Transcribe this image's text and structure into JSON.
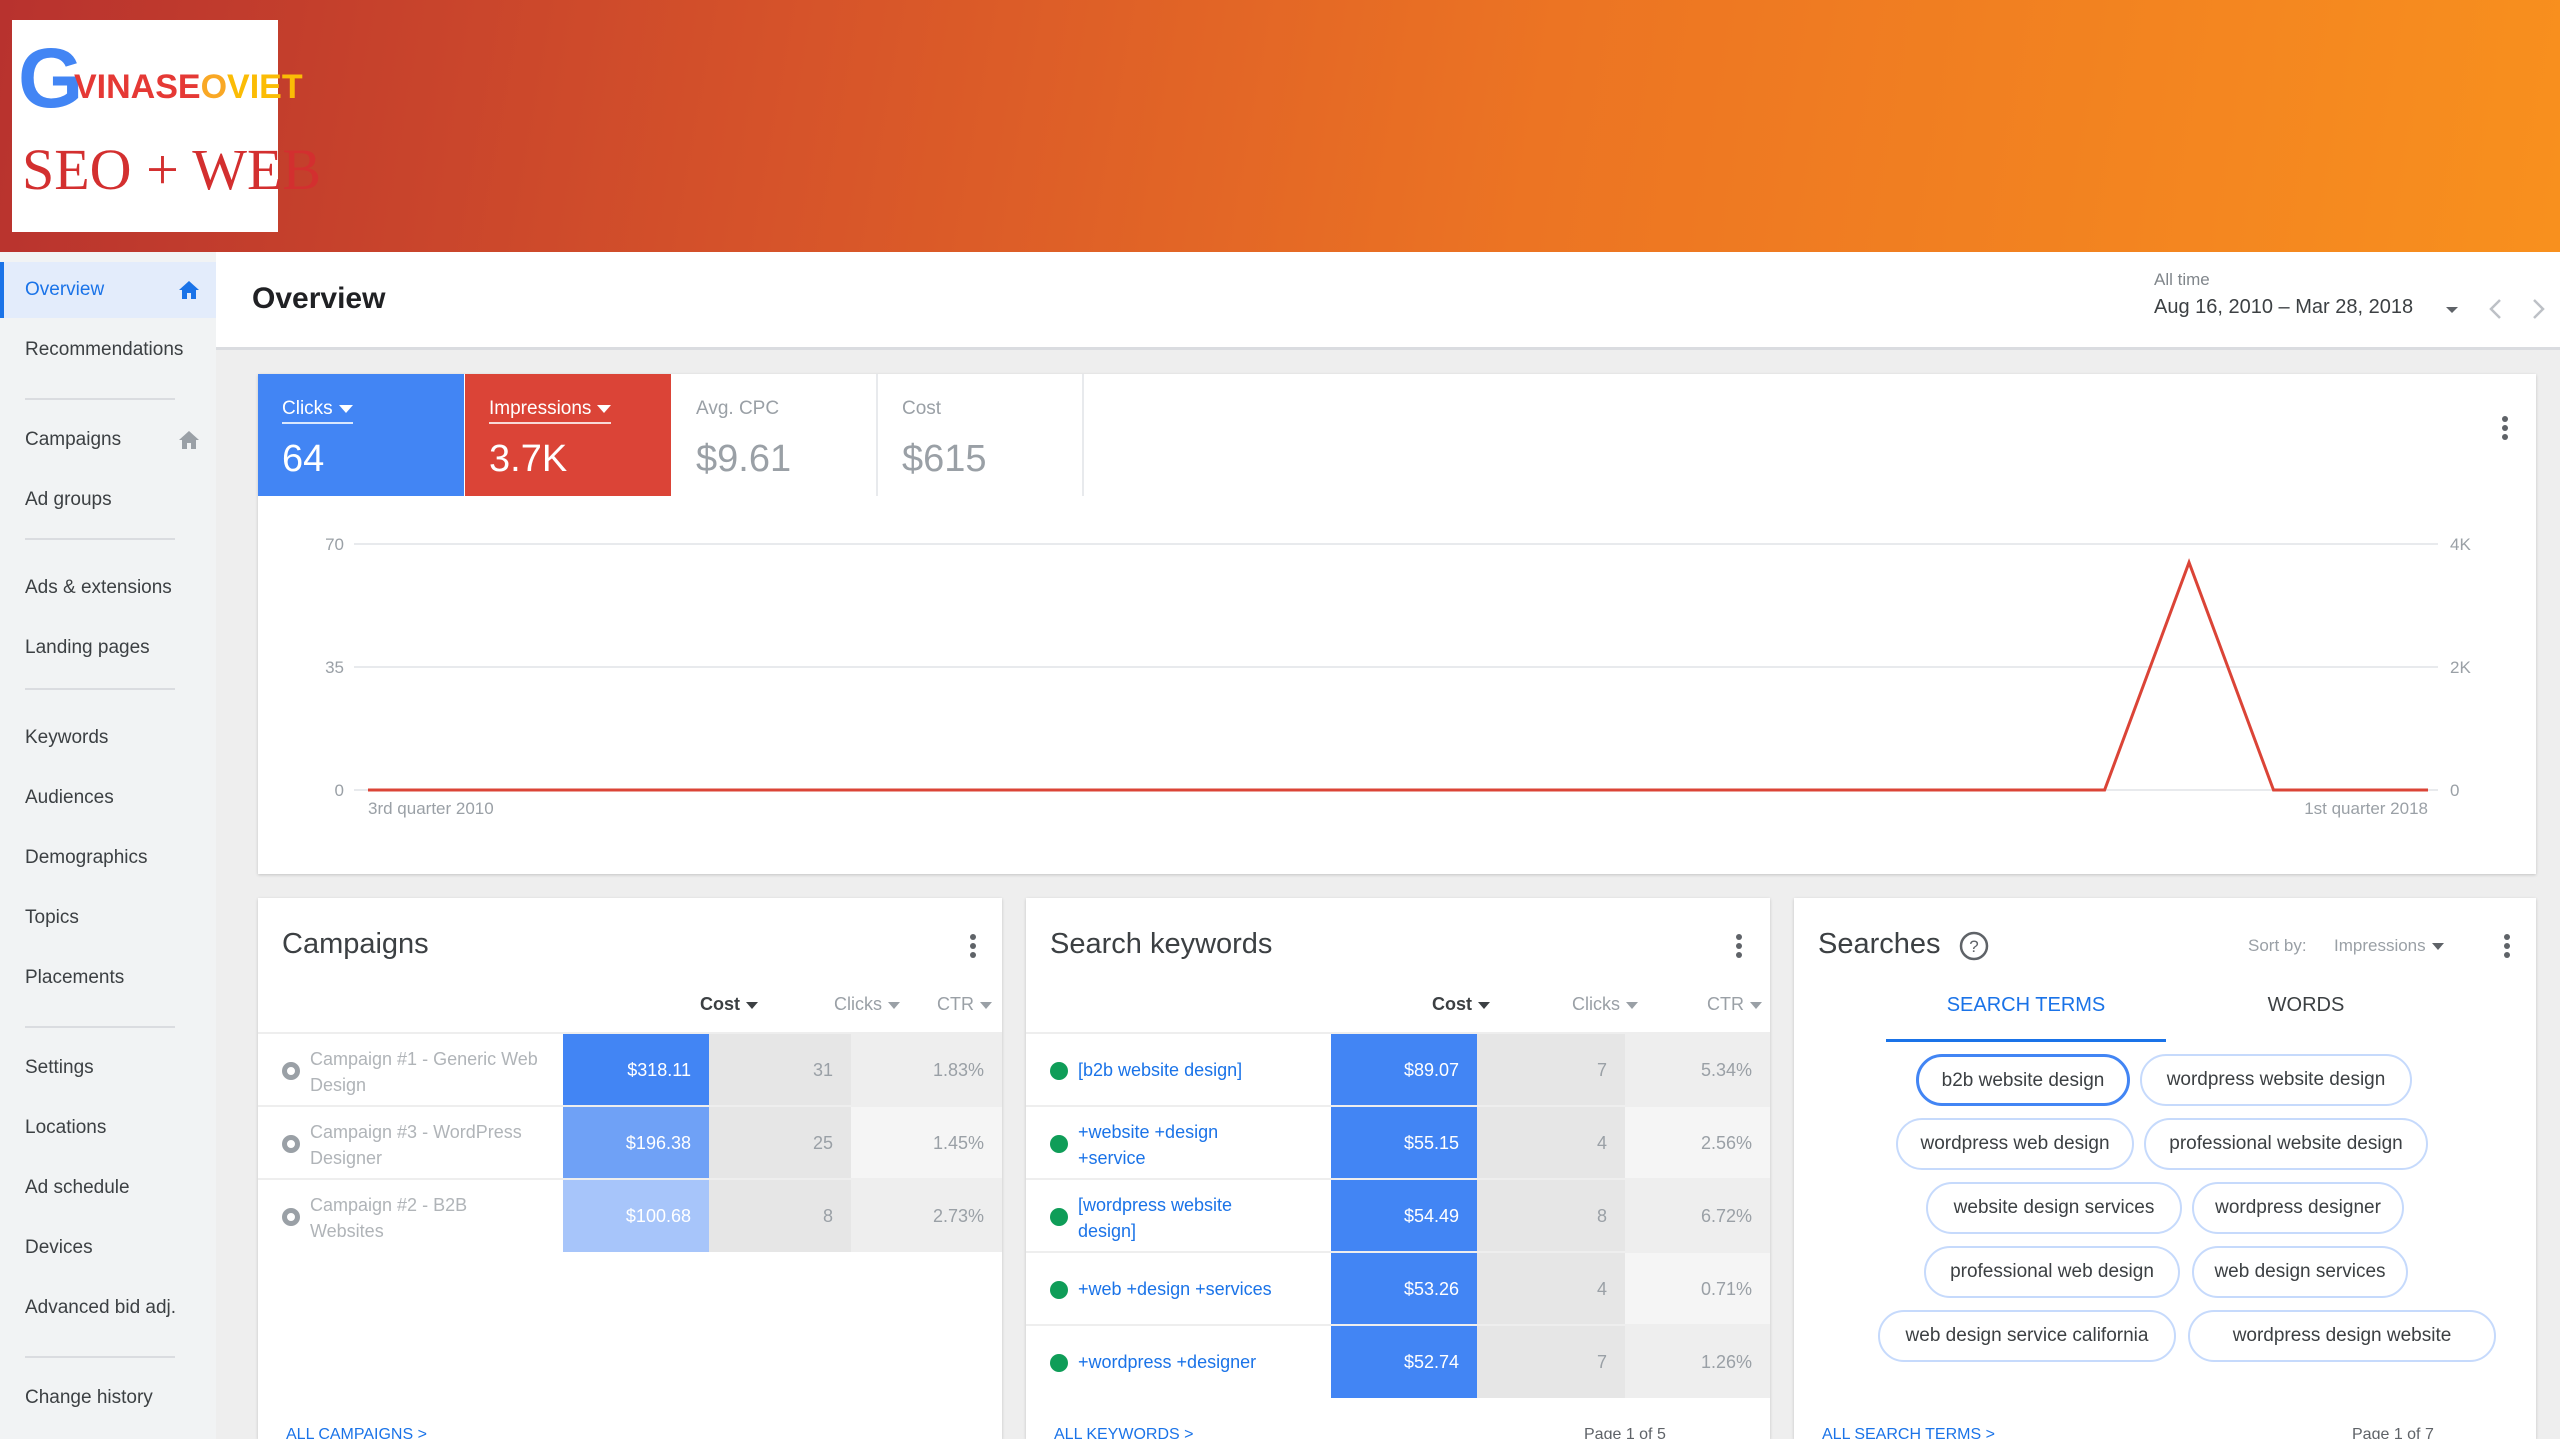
{
  "brand": {
    "logo_letter": "G",
    "logo_name_a": "VINASE",
    "logo_name_b": "O",
    "logo_name_c": "VIET",
    "tagline": "SEO + WEB"
  },
  "sidebar": {
    "items": [
      {
        "label": "Overview",
        "active": true
      },
      {
        "label": "Recommendations"
      },
      {
        "label": "Campaigns"
      },
      {
        "label": "Ad groups"
      },
      {
        "label": "Ads & extensions"
      },
      {
        "label": "Landing pages"
      },
      {
        "label": "Keywords"
      },
      {
        "label": "Audiences"
      },
      {
        "label": "Demographics"
      },
      {
        "label": "Topics"
      },
      {
        "label": "Placements"
      },
      {
        "label": "Settings"
      },
      {
        "label": "Locations"
      },
      {
        "label": "Ad schedule"
      },
      {
        "label": "Devices"
      },
      {
        "label": "Advanced bid adj."
      },
      {
        "label": "Change history"
      }
    ]
  },
  "header": {
    "title": "Overview",
    "date_label": "All time",
    "date_range": "Aug 16, 2010 – Mar 28, 2018"
  },
  "metrics": {
    "clicks": {
      "label": "Clicks",
      "value": "64",
      "color": "#4285f4"
    },
    "impressions": {
      "label": "Impressions",
      "value": "3.7K",
      "color": "#db4437"
    },
    "avg_cpc": {
      "label": "Avg. CPC",
      "value": "$9.61"
    },
    "cost": {
      "label": "Cost",
      "value": "$615"
    }
  },
  "chart_data": {
    "type": "line",
    "x_labels": [
      "3rd quarter 2010",
      "1st quarter 2018"
    ],
    "y_left_ticks": [
      "70",
      "35",
      "0"
    ],
    "y_right_ticks": [
      "4K",
      "2K",
      "0"
    ],
    "ylim_left": [
      0,
      70
    ],
    "ylim_right": [
      0,
      4000
    ],
    "series": [
      {
        "name": "Impressions",
        "color": "#db4437",
        "axis": "right",
        "points": [
          [
            0,
            0
          ],
          [
            0.843,
            0
          ],
          [
            0.884,
            3700
          ],
          [
            0.925,
            0
          ],
          [
            1,
            0
          ]
        ]
      }
    ],
    "grid": true
  },
  "campaigns": {
    "title": "Campaigns",
    "columns": {
      "cost": "Cost",
      "clicks": "Clicks",
      "ctr": "CTR"
    },
    "rows": [
      {
        "name": "Campaign #1 - Generic Web Design",
        "cost": "$318.11",
        "clicks": "31",
        "ctr": "1.83%",
        "shade": "#4285f4"
      },
      {
        "name": "Campaign #3 - WordPress Designer",
        "cost": "$196.38",
        "clicks": "25",
        "ctr": "1.45%",
        "shade": "#6fa1f6"
      },
      {
        "name": "Campaign #2 - B2B Websites",
        "cost": "$100.68",
        "clicks": "8",
        "ctr": "2.73%",
        "shade": "#a7c5fa"
      }
    ],
    "footer": "ALL CAMPAIGNS  >"
  },
  "keywords": {
    "title": "Search keywords",
    "columns": {
      "cost": "Cost",
      "clicks": "Clicks",
      "ctr": "CTR"
    },
    "rows": [
      {
        "name": "[b2b website design]",
        "cost": "$89.07",
        "clicks": "7",
        "ctr": "5.34%"
      },
      {
        "name": "+website +design +service",
        "cost": "$55.15",
        "clicks": "4",
        "ctr": "2.56%"
      },
      {
        "name": "[wordpress website design]",
        "cost": "$54.49",
        "clicks": "8",
        "ctr": "6.72%"
      },
      {
        "name": "+web +design +services",
        "cost": "$53.26",
        "clicks": "4",
        "ctr": "0.71%"
      },
      {
        "name": "+wordpress +designer",
        "cost": "$52.74",
        "clicks": "7",
        "ctr": "1.26%"
      }
    ],
    "footer": "ALL KEYWORDS  >",
    "pagination": "Page 1 of 5"
  },
  "searches": {
    "title": "Searches",
    "sort_label": "Sort by:",
    "sort_value": "Impressions",
    "tabs": [
      "SEARCH TERMS",
      "WORDS"
    ],
    "chips": [
      "b2b website design",
      "wordpress website design",
      "wordpress web design",
      "professional website design",
      "website design services",
      "wordpress designer",
      "professional web design",
      "web design services",
      "web design service california",
      "wordpress design website"
    ],
    "footer": "ALL SEARCH TERMS  >",
    "pagination": "Page 1 of 7"
  }
}
